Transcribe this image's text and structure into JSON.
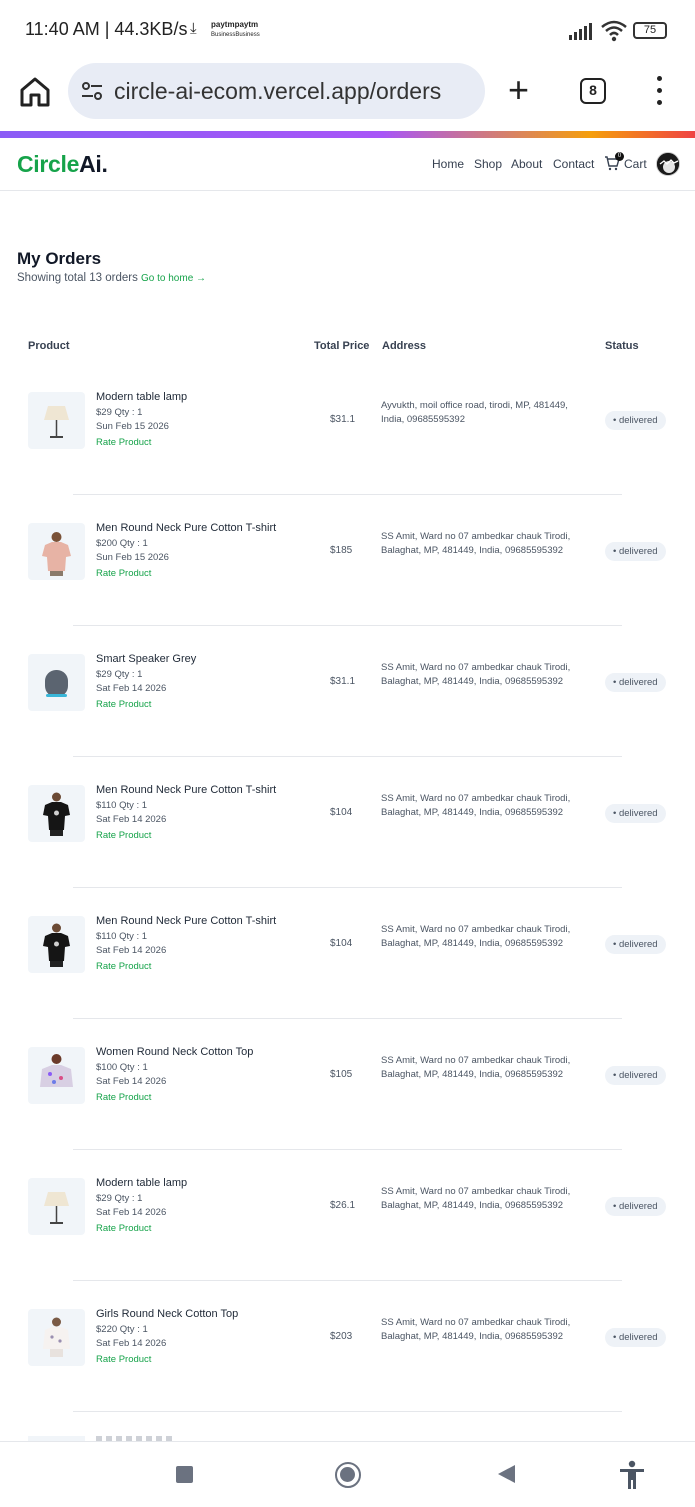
{
  "status_bar": {
    "time": "11:40 AM | 44.3KB/s",
    "download_icon": "download-icon",
    "paytm_label_top": "paytmpaytm",
    "paytm_label_bottom": "BusinessBusiness",
    "battery": "75"
  },
  "browser": {
    "url": "circle-ai-ecom.vercel.app/orders",
    "tab_count": "8",
    "plus": "+"
  },
  "site": {
    "logo_left": "Circle",
    "logo_right": "Ai.",
    "nav": [
      "Home",
      "Shop",
      "About",
      "Contact"
    ],
    "cart_count": "0",
    "cart_label": "Cart"
  },
  "page": {
    "title": "My Orders",
    "subtitle": "Showing total 13 orders",
    "go_home": "Go to home →"
  },
  "table": {
    "headers": {
      "product": "Product",
      "total_price": "Total Price",
      "address": "Address",
      "status": "Status"
    },
    "rate_label": "Rate Product",
    "rows": [
      {
        "name": "Modern table lamp",
        "price_qty": "$29 Qty : 1",
        "date": "Sun Feb 15 2026",
        "total": "$31.1",
        "address": "Ayvukth, moil office road, tirodi, MP, 481449, India, 09685595392",
        "status": "• delivered",
        "image": "lamp"
      },
      {
        "name": "Men Round Neck Pure Cotton T-shirt",
        "price_qty": "$200 Qty : 1",
        "date": "Sun Feb 15 2026",
        "total": "$185",
        "address": "SS Amit, Ward no 07 ambedkar chauk Tirodi, Balaghat, MP, 481449, India, 09685595392",
        "status": "• delivered",
        "image": "tshirt-pink"
      },
      {
        "name": "Smart Speaker Grey",
        "price_qty": "$29 Qty : 1",
        "date": "Sat Feb 14 2026",
        "total": "$31.1",
        "address": "SS Amit, Ward no 07 ambedkar chauk Tirodi, Balaghat, MP, 481449, India, 09685595392",
        "status": "• delivered",
        "image": "speaker"
      },
      {
        "name": "Men Round Neck Pure Cotton T-shirt",
        "price_qty": "$110 Qty : 1",
        "date": "Sat Feb 14 2026",
        "total": "$104",
        "address": "SS Amit, Ward no 07 ambedkar chauk Tirodi, Balaghat, MP, 481449, India, 09685595392",
        "status": "• delivered",
        "image": "tshirt-black"
      },
      {
        "name": "Men Round Neck Pure Cotton T-shirt",
        "price_qty": "$110 Qty : 1",
        "date": "Sat Feb 14 2026",
        "total": "$104",
        "address": "SS Amit, Ward no 07 ambedkar chauk Tirodi, Balaghat, MP, 481449, India, 09685595392",
        "status": "• delivered",
        "image": "tshirt-black"
      },
      {
        "name": "Women Round Neck Cotton Top",
        "price_qty": "$100 Qty : 1",
        "date": "Sat Feb 14 2026",
        "total": "$105",
        "address": "SS Amit, Ward no 07 ambedkar chauk Tirodi, Balaghat, MP, 481449, India, 09685595392",
        "status": "• delivered",
        "image": "women-top"
      },
      {
        "name": "Modern table lamp",
        "price_qty": "$29 Qty : 1",
        "date": "Sat Feb 14 2026",
        "total": "$26.1",
        "address": "SS Amit, Ward no 07 ambedkar chauk Tirodi, Balaghat, MP, 481449, India, 09685595392",
        "status": "• delivered",
        "image": "lamp"
      },
      {
        "name": "Girls Round Neck Cotton Top",
        "price_qty": "$220 Qty : 1",
        "date": "Sat Feb 14 2026",
        "total": "$203",
        "address": "SS Amit, Ward no 07 ambedkar chauk Tirodi, Balaghat, MP, 481449, India, 09685595392",
        "status": "• delivered",
        "image": "girls-top"
      }
    ]
  },
  "colors": {
    "accent_green": "#16a34a",
    "status_badge_bg": "#eef2f7"
  }
}
